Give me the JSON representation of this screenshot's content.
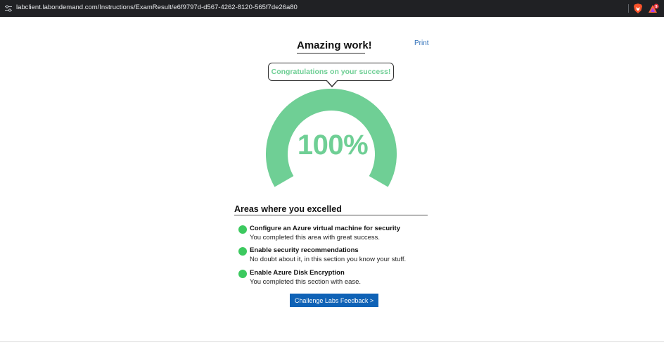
{
  "browser": {
    "url": "labclient.labondemand.com/Instructions/ExamResult/e6f9797d-d567-4262-8120-565f7de26a80",
    "rewards_badge": "9",
    "icons": [
      "site-info-icon",
      "brave-shield-icon",
      "brave-rewards-icon"
    ]
  },
  "result": {
    "heading": "Amazing work!",
    "print_label": "Print",
    "bubble_text": "Congratulations on your success!",
    "score_text": "100%",
    "score_fraction": 1.0
  },
  "excelled": {
    "title": "Areas where you excelled",
    "areas": [
      {
        "title": "Configure an Azure virtual machine for security",
        "description": "You completed this area with great success."
      },
      {
        "title": "Enable security recommendations",
        "description": "No doubt about it, in this section you know your stuff."
      },
      {
        "title": "Enable Azure Disk Encryption",
        "description": "You completed this section with ease."
      }
    ]
  },
  "feedback_button": "Challenge Labs Feedback >",
  "colors": {
    "accent_green": "#6fcf95",
    "dot_green": "#3cc95f",
    "button_blue": "#0f62b6",
    "link_blue": "#2f6fb8",
    "topbar": "#202124"
  }
}
